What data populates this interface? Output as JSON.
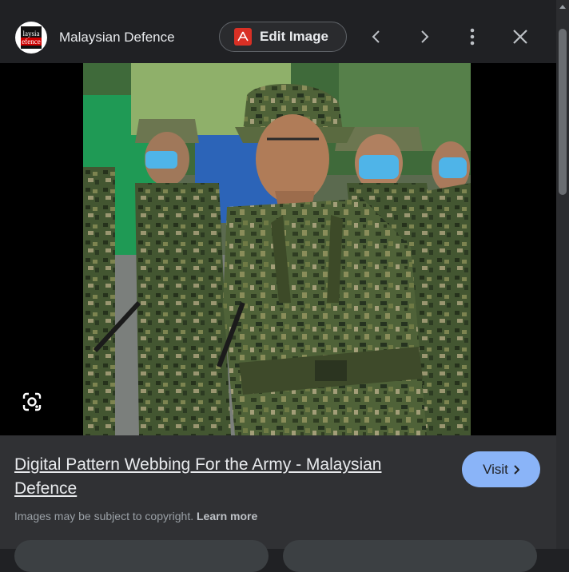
{
  "header": {
    "logo_lines": [
      "laysia",
      "efence"
    ],
    "site_name": "Malaysian Defence",
    "edit_label": "Edit Image",
    "icons": [
      "pdf-icon",
      "chevron-left-icon",
      "chevron-right-icon",
      "more-vert-icon",
      "close-icon"
    ]
  },
  "image": {
    "alt": "Soldiers in digital camouflage uniforms with webbing standing in formation",
    "lens_icon": "google-lens-icon"
  },
  "info": {
    "title": "Digital Pattern Webbing For the Army - Malaysian Defence",
    "visit_label": "Visit",
    "copyright_text": "Images may be subject to copyright.",
    "learn_more": "Learn more"
  },
  "colors": {
    "background": "#202124",
    "panel": "#303134",
    "accent": "#8ab4f8",
    "pdf_red": "#d93025"
  }
}
